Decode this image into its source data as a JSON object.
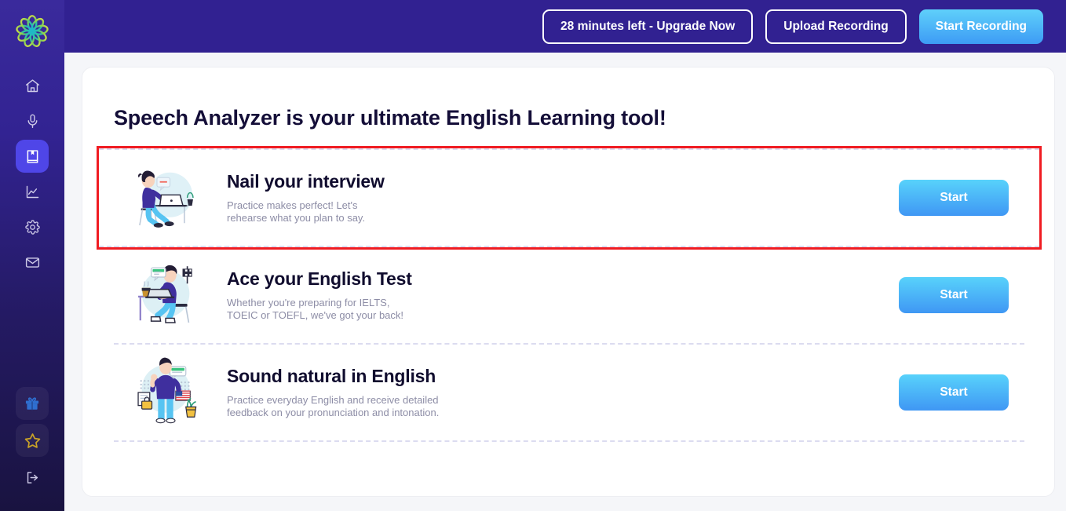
{
  "header": {
    "logo_icon": "flower-logo-icon",
    "buttons": [
      {
        "label": "28 minutes left - Upgrade Now",
        "name": "upgrade-now-button",
        "style": "outline"
      },
      {
        "label": "Upload Recording",
        "name": "upload-recording-button",
        "style": "outline"
      },
      {
        "label": "Start Recording",
        "name": "start-recording-button",
        "style": "primary"
      }
    ]
  },
  "sidebar": {
    "top_items": [
      {
        "icon": "home-icon",
        "name": "sidebar-item-home",
        "active": false
      },
      {
        "icon": "microphone-icon",
        "name": "sidebar-item-recordings",
        "active": false
      },
      {
        "icon": "book-icon",
        "name": "sidebar-item-library",
        "active": true
      },
      {
        "icon": "chart-line-icon",
        "name": "sidebar-item-analytics",
        "active": false
      },
      {
        "icon": "gear-icon",
        "name": "sidebar-item-settings",
        "active": false
      },
      {
        "icon": "envelope-icon",
        "name": "sidebar-item-messages",
        "active": false
      }
    ],
    "bottom_items": [
      {
        "icon": "gift-icon",
        "name": "sidebar-item-rewards",
        "tinted": true
      },
      {
        "icon": "star-icon",
        "name": "sidebar-item-favorites",
        "tinted": true
      },
      {
        "icon": "logout-icon",
        "name": "sidebar-item-logout",
        "tinted": false
      }
    ]
  },
  "main": {
    "title": "Speech Analyzer is your ultimate English Learning tool!",
    "cards": [
      {
        "title": "Nail your interview",
        "description": "Practice makes perfect! Let's\nrehearse what you plan to say.",
        "button_label": "Start",
        "illustration": "person-at-laptop-illustration",
        "highlighted": true
      },
      {
        "title": "Ace your English Test",
        "description": "Whether you're preparing for IELTS,\nTOEIC or TOEFL, we've got your back!",
        "button_label": "Start",
        "illustration": "person-studying-at-desk-illustration",
        "highlighted": false
      },
      {
        "title": "Sound natural in English",
        "description": "Practice everyday English and receive detailed\nfeedback on your pronunciation and intonation.",
        "button_label": "Start",
        "illustration": "person-waving-with-flag-illustration",
        "highlighted": false
      }
    ]
  },
  "colors": {
    "header_purple": "#312191",
    "sidebar_top": "#3a2a9c",
    "sidebar_bottom": "#191340",
    "active_nav": "#4f46e8",
    "accent_blue_light": "#58d2fb",
    "accent_blue_dark": "#3f97f4",
    "highlight_red": "#f01c22",
    "page_background": "#f5f6f9",
    "dashed_divider": "#dcdcf0",
    "title_text": "#140e38",
    "muted_text": "#8d8da6",
    "star_gold": "#c9a227",
    "gift_blue": "#2f6fd0"
  }
}
